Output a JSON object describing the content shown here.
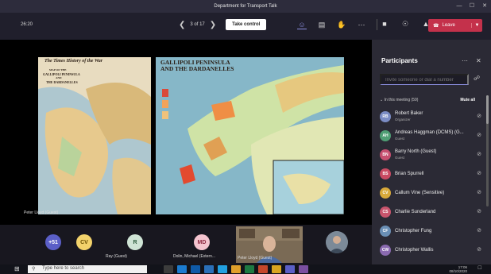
{
  "window": {
    "title": "Department for Transport Talk"
  },
  "toolbar": {
    "timer": "26:20",
    "page_counter": "3 of 17",
    "take_control_label": "Take control",
    "leave_label": "Leave"
  },
  "presentation": {
    "map_left_title": "The Times History of the War",
    "map_left_sub1": "MAP OF THE",
    "map_left_sub2": "GALLIPOLI PENINSULA",
    "map_left_sub3": "AND",
    "map_left_sub4": "THE DARDANELLES",
    "map_right_title_1": "GALLIPOLI PENINSULA",
    "map_right_title_2": "AND THE DARDANELLES",
    "presenter_caption": "Peter Lloyd (Guest)"
  },
  "participants": {
    "header": "Participants",
    "invite_placeholder": "Invite someone or dial a number",
    "section_label": "In this meeting (59)",
    "mute_all_label": "Mute all",
    "people": [
      {
        "name": "Robert Baker",
        "role": "Organizer",
        "initials": "RB",
        "color": "#7b8cc4"
      },
      {
        "name": "Andreas Haggman (DCMS) (G...",
        "role": "Guest",
        "initials": "AH",
        "color": "#4f9e74"
      },
      {
        "name": "Barry North (Guest)",
        "role": "Guest",
        "initials": "BN",
        "color": "#c64f6f"
      },
      {
        "name": "Brian Spurrell",
        "role": "",
        "initials": "BS",
        "color": "#c94a62"
      },
      {
        "name": "Callum Vine (Sensitive)",
        "role": "",
        "initials": "CV",
        "color": "#d8a93a"
      },
      {
        "name": "Charlie Sunderland",
        "role": "",
        "initials": "CS",
        "color": "#c9556d"
      },
      {
        "name": "Christopher Fung",
        "role": "",
        "initials": "CF",
        "color": "#6a8fb5"
      },
      {
        "name": "Christopher Wallis",
        "role": "",
        "initials": "CW",
        "color": "#8a6ab0"
      }
    ]
  },
  "strip": {
    "more_count": "+51",
    "cv_initials": "CV",
    "r_initials": "R",
    "r_name": "Ray (Guest)",
    "md_initials": "MD",
    "md_name": "Dolin, Michael (Extern...",
    "video_name": "Peter Lloyd (Guest)"
  },
  "taskbar": {
    "search_placeholder": "Type here to search",
    "time": "17:06",
    "date": "08/10/2020"
  },
  "colors": {
    "accent": "#8c8fe0",
    "leave": "#c4314b"
  }
}
